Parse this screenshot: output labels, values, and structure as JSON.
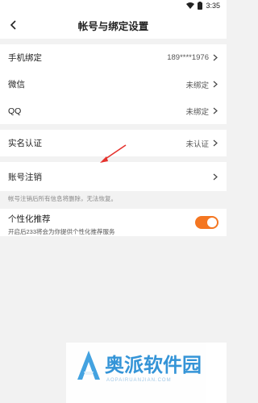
{
  "status_bar": {
    "time": "3:35"
  },
  "header": {
    "title": "帐号与绑定设置"
  },
  "bindings": [
    {
      "label": "手机绑定",
      "value": "189****1976"
    },
    {
      "label": "微信",
      "value": "未绑定"
    },
    {
      "label": "QQ",
      "value": "未绑定"
    }
  ],
  "realname": {
    "label": "实名认证",
    "value": "未认证"
  },
  "cancel": {
    "label": "账号注销",
    "note": "帐号注销后所有信息将删除，无法恢复。"
  },
  "personalization": {
    "title": "个性化推荐",
    "desc": "开启后233将会为你提供个性化推荐服务",
    "enabled": true
  },
  "colors": {
    "accent": "#f47621"
  },
  "watermark": {
    "text": "奥派软件园",
    "sub": "AOPAIRUANJIAN.COM"
  }
}
